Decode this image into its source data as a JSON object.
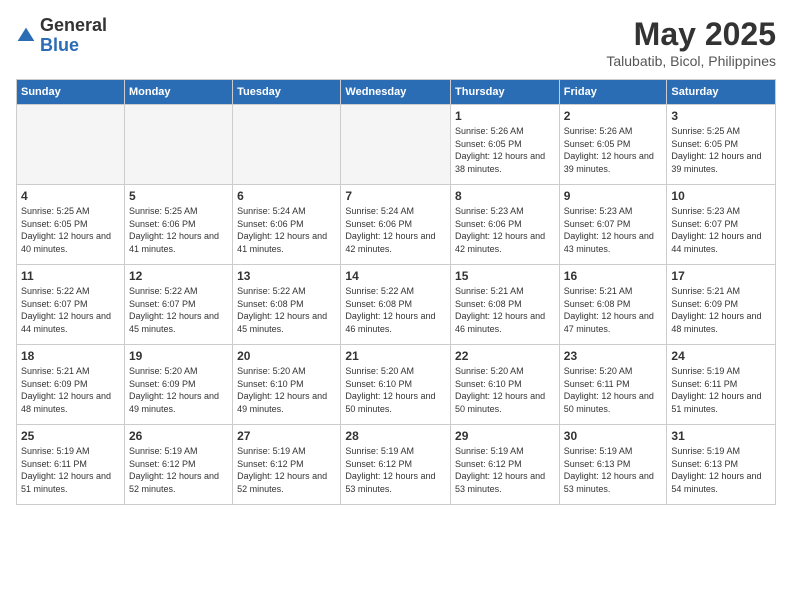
{
  "header": {
    "logo_general": "General",
    "logo_blue": "Blue",
    "title": "May 2025",
    "location": "Talubatib, Bicol, Philippines"
  },
  "days_of_week": [
    "Sunday",
    "Monday",
    "Tuesday",
    "Wednesday",
    "Thursday",
    "Friday",
    "Saturday"
  ],
  "weeks": [
    [
      {
        "day": "",
        "empty": true
      },
      {
        "day": "",
        "empty": true
      },
      {
        "day": "",
        "empty": true
      },
      {
        "day": "",
        "empty": true
      },
      {
        "day": "1",
        "sunrise": "5:26 AM",
        "sunset": "6:05 PM",
        "daylight": "12 hours and 38 minutes."
      },
      {
        "day": "2",
        "sunrise": "5:26 AM",
        "sunset": "6:05 PM",
        "daylight": "12 hours and 39 minutes."
      },
      {
        "day": "3",
        "sunrise": "5:25 AM",
        "sunset": "6:05 PM",
        "daylight": "12 hours and 39 minutes."
      }
    ],
    [
      {
        "day": "4",
        "sunrise": "5:25 AM",
        "sunset": "6:05 PM",
        "daylight": "12 hours and 40 minutes."
      },
      {
        "day": "5",
        "sunrise": "5:25 AM",
        "sunset": "6:06 PM",
        "daylight": "12 hours and 41 minutes."
      },
      {
        "day": "6",
        "sunrise": "5:24 AM",
        "sunset": "6:06 PM",
        "daylight": "12 hours and 41 minutes."
      },
      {
        "day": "7",
        "sunrise": "5:24 AM",
        "sunset": "6:06 PM",
        "daylight": "12 hours and 42 minutes."
      },
      {
        "day": "8",
        "sunrise": "5:23 AM",
        "sunset": "6:06 PM",
        "daylight": "12 hours and 42 minutes."
      },
      {
        "day": "9",
        "sunrise": "5:23 AM",
        "sunset": "6:07 PM",
        "daylight": "12 hours and 43 minutes."
      },
      {
        "day": "10",
        "sunrise": "5:23 AM",
        "sunset": "6:07 PM",
        "daylight": "12 hours and 44 minutes."
      }
    ],
    [
      {
        "day": "11",
        "sunrise": "5:22 AM",
        "sunset": "6:07 PM",
        "daylight": "12 hours and 44 minutes."
      },
      {
        "day": "12",
        "sunrise": "5:22 AM",
        "sunset": "6:07 PM",
        "daylight": "12 hours and 45 minutes."
      },
      {
        "day": "13",
        "sunrise": "5:22 AM",
        "sunset": "6:08 PM",
        "daylight": "12 hours and 45 minutes."
      },
      {
        "day": "14",
        "sunrise": "5:22 AM",
        "sunset": "6:08 PM",
        "daylight": "12 hours and 46 minutes."
      },
      {
        "day": "15",
        "sunrise": "5:21 AM",
        "sunset": "6:08 PM",
        "daylight": "12 hours and 46 minutes."
      },
      {
        "day": "16",
        "sunrise": "5:21 AM",
        "sunset": "6:08 PM",
        "daylight": "12 hours and 47 minutes."
      },
      {
        "day": "17",
        "sunrise": "5:21 AM",
        "sunset": "6:09 PM",
        "daylight": "12 hours and 48 minutes."
      }
    ],
    [
      {
        "day": "18",
        "sunrise": "5:21 AM",
        "sunset": "6:09 PM",
        "daylight": "12 hours and 48 minutes."
      },
      {
        "day": "19",
        "sunrise": "5:20 AM",
        "sunset": "6:09 PM",
        "daylight": "12 hours and 49 minutes."
      },
      {
        "day": "20",
        "sunrise": "5:20 AM",
        "sunset": "6:10 PM",
        "daylight": "12 hours and 49 minutes."
      },
      {
        "day": "21",
        "sunrise": "5:20 AM",
        "sunset": "6:10 PM",
        "daylight": "12 hours and 50 minutes."
      },
      {
        "day": "22",
        "sunrise": "5:20 AM",
        "sunset": "6:10 PM",
        "daylight": "12 hours and 50 minutes."
      },
      {
        "day": "23",
        "sunrise": "5:20 AM",
        "sunset": "6:11 PM",
        "daylight": "12 hours and 50 minutes."
      },
      {
        "day": "24",
        "sunrise": "5:19 AM",
        "sunset": "6:11 PM",
        "daylight": "12 hours and 51 minutes."
      }
    ],
    [
      {
        "day": "25",
        "sunrise": "5:19 AM",
        "sunset": "6:11 PM",
        "daylight": "12 hours and 51 minutes."
      },
      {
        "day": "26",
        "sunrise": "5:19 AM",
        "sunset": "6:12 PM",
        "daylight": "12 hours and 52 minutes."
      },
      {
        "day": "27",
        "sunrise": "5:19 AM",
        "sunset": "6:12 PM",
        "daylight": "12 hours and 52 minutes."
      },
      {
        "day": "28",
        "sunrise": "5:19 AM",
        "sunset": "6:12 PM",
        "daylight": "12 hours and 53 minutes."
      },
      {
        "day": "29",
        "sunrise": "5:19 AM",
        "sunset": "6:12 PM",
        "daylight": "12 hours and 53 minutes."
      },
      {
        "day": "30",
        "sunrise": "5:19 AM",
        "sunset": "6:13 PM",
        "daylight": "12 hours and 53 minutes."
      },
      {
        "day": "31",
        "sunrise": "5:19 AM",
        "sunset": "6:13 PM",
        "daylight": "12 hours and 54 minutes."
      }
    ]
  ]
}
